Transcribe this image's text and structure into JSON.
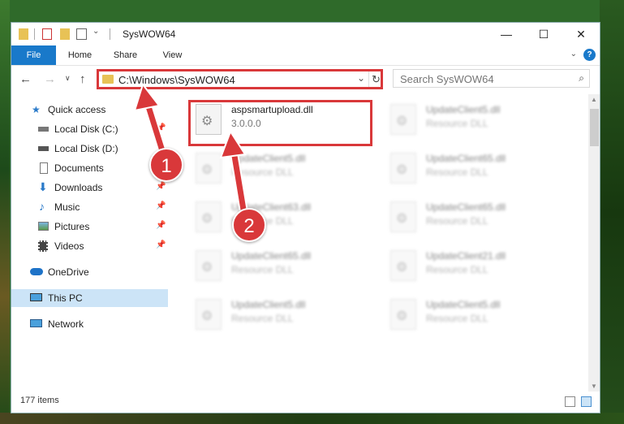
{
  "window": {
    "title": "SysWOW64",
    "controls": {
      "minimize": "—",
      "maximize": "☐",
      "close": "✕"
    }
  },
  "ribbon": {
    "tabs": [
      "File",
      "Home",
      "Share",
      "View"
    ],
    "help": "?"
  },
  "navigation": {
    "back": "←",
    "forward": "→",
    "recent": "∨",
    "up": "↑",
    "address": "C:\\Windows\\SysWOW64",
    "refresh": "↻",
    "search_placeholder": "Search SysWOW64"
  },
  "sidebar": {
    "items": [
      {
        "label": "Quick access",
        "icon": "star-icon",
        "pinned": false
      },
      {
        "label": "Local Disk (C:)",
        "icon": "drive-icon",
        "pinned": true
      },
      {
        "label": "Local Disk (D:)",
        "icon": "drive-icon",
        "pinned": false
      },
      {
        "label": "Documents",
        "icon": "document-icon",
        "pinned": true
      },
      {
        "label": "Downloads",
        "icon": "download-icon",
        "pinned": true
      },
      {
        "label": "Music",
        "icon": "music-icon",
        "pinned": true
      },
      {
        "label": "Pictures",
        "icon": "picture-icon",
        "pinned": true
      },
      {
        "label": "Videos",
        "icon": "video-icon",
        "pinned": true
      },
      {
        "label": "OneDrive",
        "icon": "cloud-icon",
        "pinned": false
      },
      {
        "label": "This PC",
        "icon": "computer-icon",
        "pinned": false,
        "selected": true
      },
      {
        "label": "Network",
        "icon": "network-icon",
        "pinned": false
      }
    ],
    "pin_glyph": "📌"
  },
  "files": [
    {
      "name": "aspsmartupload.dll",
      "sub": "3.0.0.0",
      "highlighted": true
    },
    {
      "name": "UpdateClient5.dll",
      "sub": "Resource DLL"
    },
    {
      "name": "UpdateClient5.dll",
      "sub": "Resource DLL"
    },
    {
      "name": "UpdateClient65.dll",
      "sub": "Resource DLL"
    },
    {
      "name": "UpdateClient63.dll",
      "sub": "Resource DLL"
    },
    {
      "name": "UpdateClient65.dll",
      "sub": "Resource DLL"
    },
    {
      "name": "UpdateClient65.dll",
      "sub": "Resource DLL"
    },
    {
      "name": "UpdateClient21.dll",
      "sub": "Resource DLL"
    },
    {
      "name": "UpdateClient5.dll",
      "sub": "Resource DLL"
    },
    {
      "name": "UpdateClient5.dll",
      "sub": "Resource DLL"
    }
  ],
  "status": {
    "item_count": "177 items"
  },
  "annotations": {
    "step1": "1",
    "step2": "2",
    "color": "#d9383a"
  }
}
